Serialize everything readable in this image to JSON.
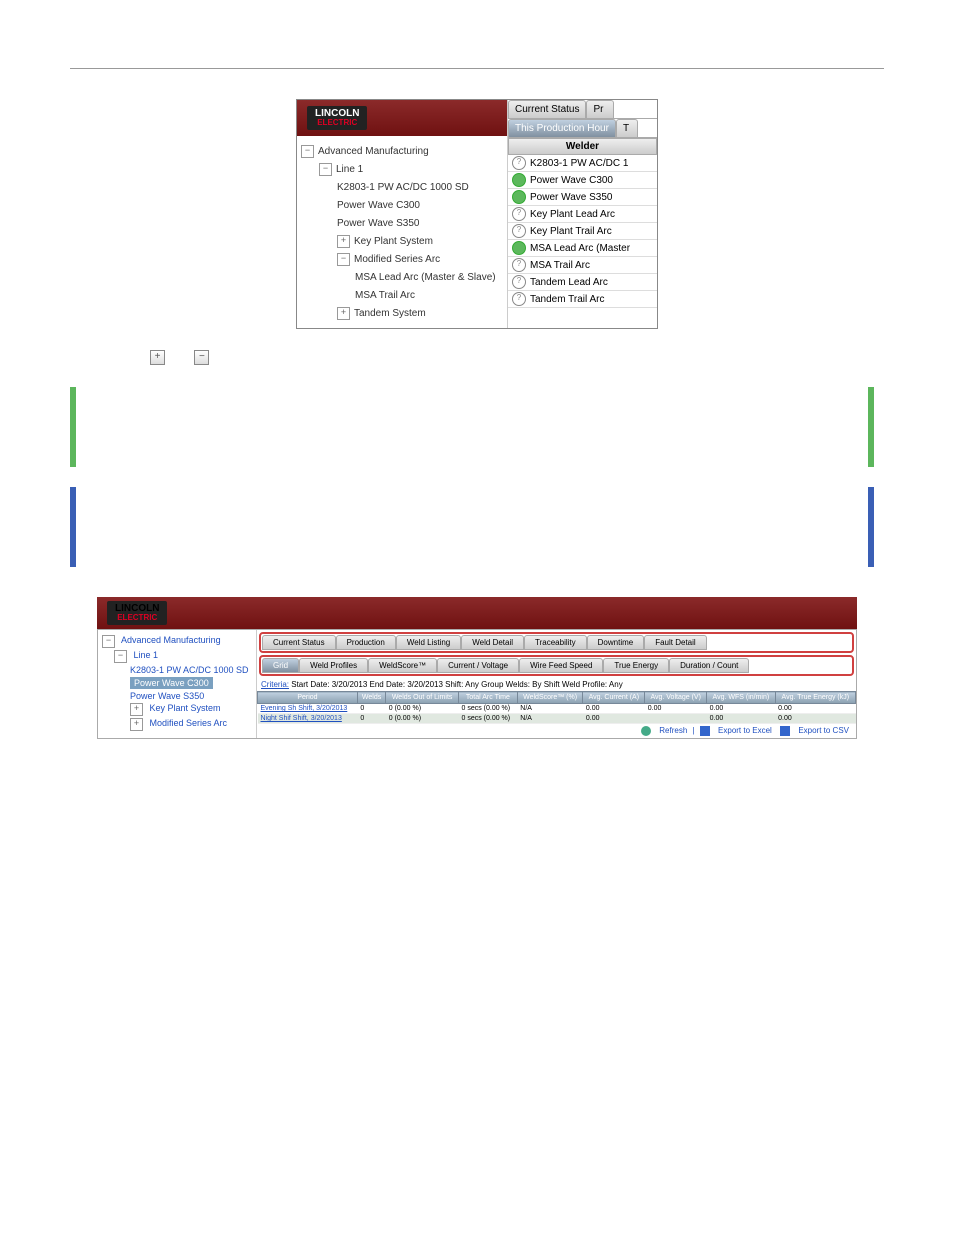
{
  "logo": {
    "line1": "LINCOLN",
    "line2": "ELECTRIC"
  },
  "figure1": {
    "tree": [
      {
        "level": 0,
        "icon": "−",
        "label": "Advanced Manufacturing"
      },
      {
        "level": 1,
        "icon": "−",
        "label": "Line 1"
      },
      {
        "level": 2,
        "icon": "",
        "label": "K2803-1 PW AC/DC 1000 SD"
      },
      {
        "level": 2,
        "icon": "",
        "label": "Power Wave C300"
      },
      {
        "level": 2,
        "icon": "",
        "label": "Power Wave S350"
      },
      {
        "level": 2,
        "icon": "+",
        "label": "Key Plant System"
      },
      {
        "level": 2,
        "icon": "−",
        "label": "Modified Series Arc"
      },
      {
        "level": 3,
        "icon": "",
        "label": "MSA Lead Arc (Master & Slave)"
      },
      {
        "level": 3,
        "icon": "",
        "label": "MSA Trail Arc"
      },
      {
        "level": 2,
        "icon": "+",
        "label": "Tandem System"
      }
    ],
    "right_tabs": [
      "Current Status",
      "Pr"
    ],
    "sub_tab": "This Production Hour",
    "sub_tab2": "T",
    "welder_header": "Welder",
    "welders": [
      {
        "status": "unknown",
        "name": "K2803-1 PW AC/DC 1"
      },
      {
        "status": "ok",
        "name": "Power Wave C300"
      },
      {
        "status": "ok",
        "name": "Power Wave S350"
      },
      {
        "status": "unknown",
        "name": "Key Plant Lead Arc"
      },
      {
        "status": "unknown",
        "name": "Key Plant Trail Arc"
      },
      {
        "status": "ok",
        "name": "MSA Lead Arc (Master"
      },
      {
        "status": "unknown",
        "name": "MSA Trail Arc"
      },
      {
        "status": "unknown",
        "name": "Tandem Lead Arc"
      },
      {
        "status": "unknown",
        "name": "Tandem Trail Arc"
      }
    ]
  },
  "btn_plus": "+",
  "btn_minus": "−",
  "figure2": {
    "tree": [
      {
        "level": 0,
        "label": "Advanced Manufacturing"
      },
      {
        "level": 1,
        "label": "Line 1"
      },
      {
        "level": 2,
        "label": "K2803-1 PW AC/DC 1000 SD"
      },
      {
        "level": 2,
        "label": "Power Wave C300",
        "selected": true
      },
      {
        "level": 2,
        "label": "Power Wave S350"
      },
      {
        "level": 2,
        "label": "Key Plant System"
      },
      {
        "level": 2,
        "label": "Modified Series Arc"
      }
    ],
    "tabs1": [
      "Current Status",
      "Production",
      "Weld Listing",
      "Weld Detail",
      "Traceability",
      "Downtime",
      "Fault Detail"
    ],
    "tabs2": [
      "Grid",
      "Weld Profiles",
      "WeldScore™",
      "Current / Voltage",
      "Wire Feed Speed",
      "True Energy",
      "Duration / Count"
    ],
    "criteria_label": "Criteria:",
    "criteria_text": "Start Date: 3/20/2013 End Date: 3/20/2013 Shift: Any Group Welds: By Shift Weld Profile: Any",
    "columns": [
      "Period",
      "Welds",
      "Welds Out of Limits",
      "Total Arc Time",
      "WeldScore™ (%)",
      "Avg. Current (A)",
      "Avg. Voltage (V)",
      "Avg. WFS (in/min)",
      "Avg. True Energy (kJ)"
    ],
    "rows": [
      [
        "Evening Sh Shift, 3/20/2013",
        "0",
        "0 (0.00 %)",
        "0 secs (0.00 %)",
        "N/A",
        "",
        "0.00",
        "0.00",
        "0.00",
        "0.00"
      ],
      [
        "Night Shif Shift, 3/20/2013",
        "0",
        "0 (0.00 %)",
        "0 secs (0.00 %)",
        "N/A",
        "",
        "0.00",
        "",
        "0.00",
        "0.00"
      ]
    ],
    "footer": [
      "Refresh",
      "Export to Excel",
      "Export to CSV"
    ]
  }
}
